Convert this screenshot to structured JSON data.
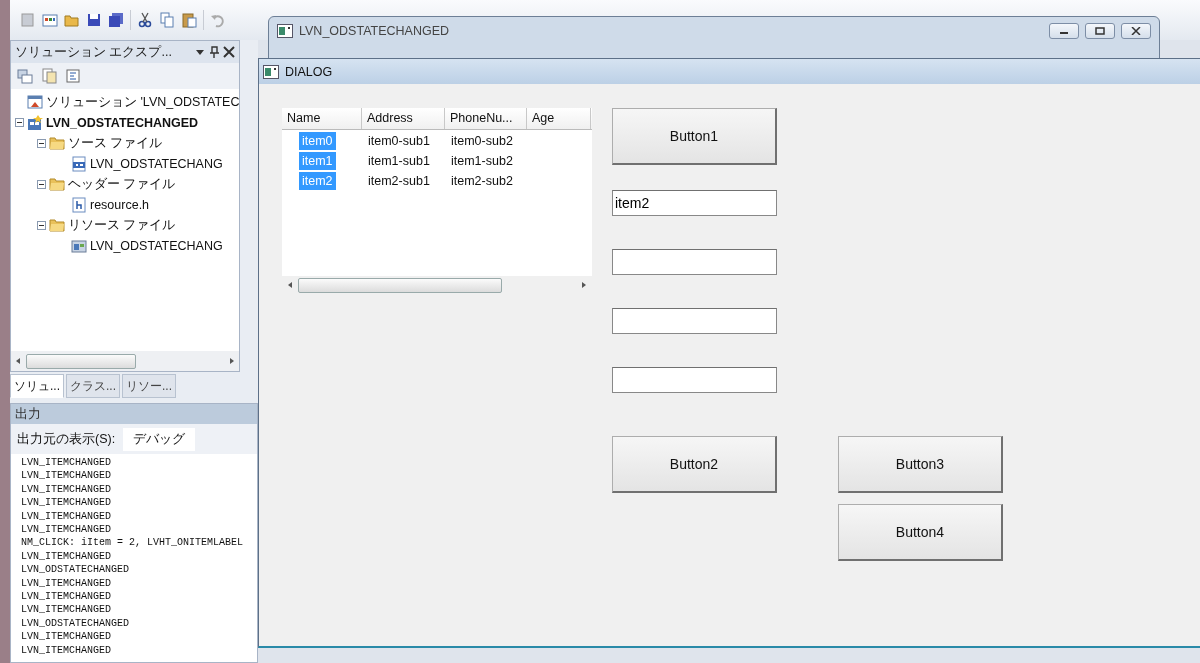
{
  "explorer": {
    "title": "ソリューション エクスプ...",
    "tree": [
      {
        "label": "ソリューション 'LVN_ODSTATEC",
        "kind": "solution"
      },
      {
        "label": "LVN_ODSTATECHANGED",
        "kind": "project",
        "expanded": true,
        "children": [
          {
            "label": "ソース ファイル",
            "kind": "folder",
            "expanded": true,
            "children": [
              {
                "label": "LVN_ODSTATECHANG",
                "kind": "cpp"
              }
            ]
          },
          {
            "label": "ヘッダー ファイル",
            "kind": "folder",
            "expanded": true,
            "children": [
              {
                "label": "resource.h",
                "kind": "header"
              }
            ]
          },
          {
            "label": "リソース ファイル",
            "kind": "folder",
            "expanded": true,
            "children": [
              {
                "label": "LVN_ODSTATECHANG",
                "kind": "resource"
              }
            ]
          }
        ]
      }
    ],
    "tabs": [
      {
        "label": "ソリュ...",
        "selected": true
      },
      {
        "label": "クラス...",
        "selected": false
      },
      {
        "label": "リソー...",
        "selected": false
      }
    ]
  },
  "output": {
    "title": "出力",
    "source_label": "出力元の表示(S):",
    "source_value": "デバッグ",
    "lines": [
      "LVN_ITEMCHANGED",
      "LVN_ITEMCHANGED",
      "LVN_ITEMCHANGED",
      "LVN_ITEMCHANGED",
      "LVN_ITEMCHANGED",
      "LVN_ITEMCHANGED",
      "NM_CLICK: iItem = 2, LVHT_ONITEMLABEL",
      "LVN_ITEMCHANGED",
      "LVN_ODSTATECHANGED",
      "LVN_ITEMCHANGED",
      "LVN_ITEMCHANGED",
      "LVN_ITEMCHANGED",
      "LVN_ODSTATECHANGED",
      "LVN_ITEMCHANGED",
      "LVN_ITEMCHANGED"
    ]
  },
  "app_window": {
    "title": "LVN_ODSTATECHANGED"
  },
  "dialog": {
    "title": "DIALOG",
    "list": {
      "columns": [
        "Name",
        "Address",
        "PhoneNu...",
        "Age"
      ],
      "rows": [
        {
          "cells": [
            "item0",
            "item0-sub1",
            "item0-sub2"
          ],
          "selected": true
        },
        {
          "cells": [
            "item1",
            "item1-sub1",
            "item1-sub2"
          ],
          "selected": true
        },
        {
          "cells": [
            "item2",
            "item2-sub1",
            "item2-sub2"
          ],
          "selected": true
        }
      ]
    },
    "buttons": [
      "Button1",
      "Button2",
      "Button3",
      "Button4"
    ],
    "edit_fields": [
      {
        "kind": "filled",
        "value": "item2"
      },
      {
        "kind": "empty"
      },
      {
        "kind": "empty"
      },
      {
        "kind": "empty"
      }
    ]
  }
}
